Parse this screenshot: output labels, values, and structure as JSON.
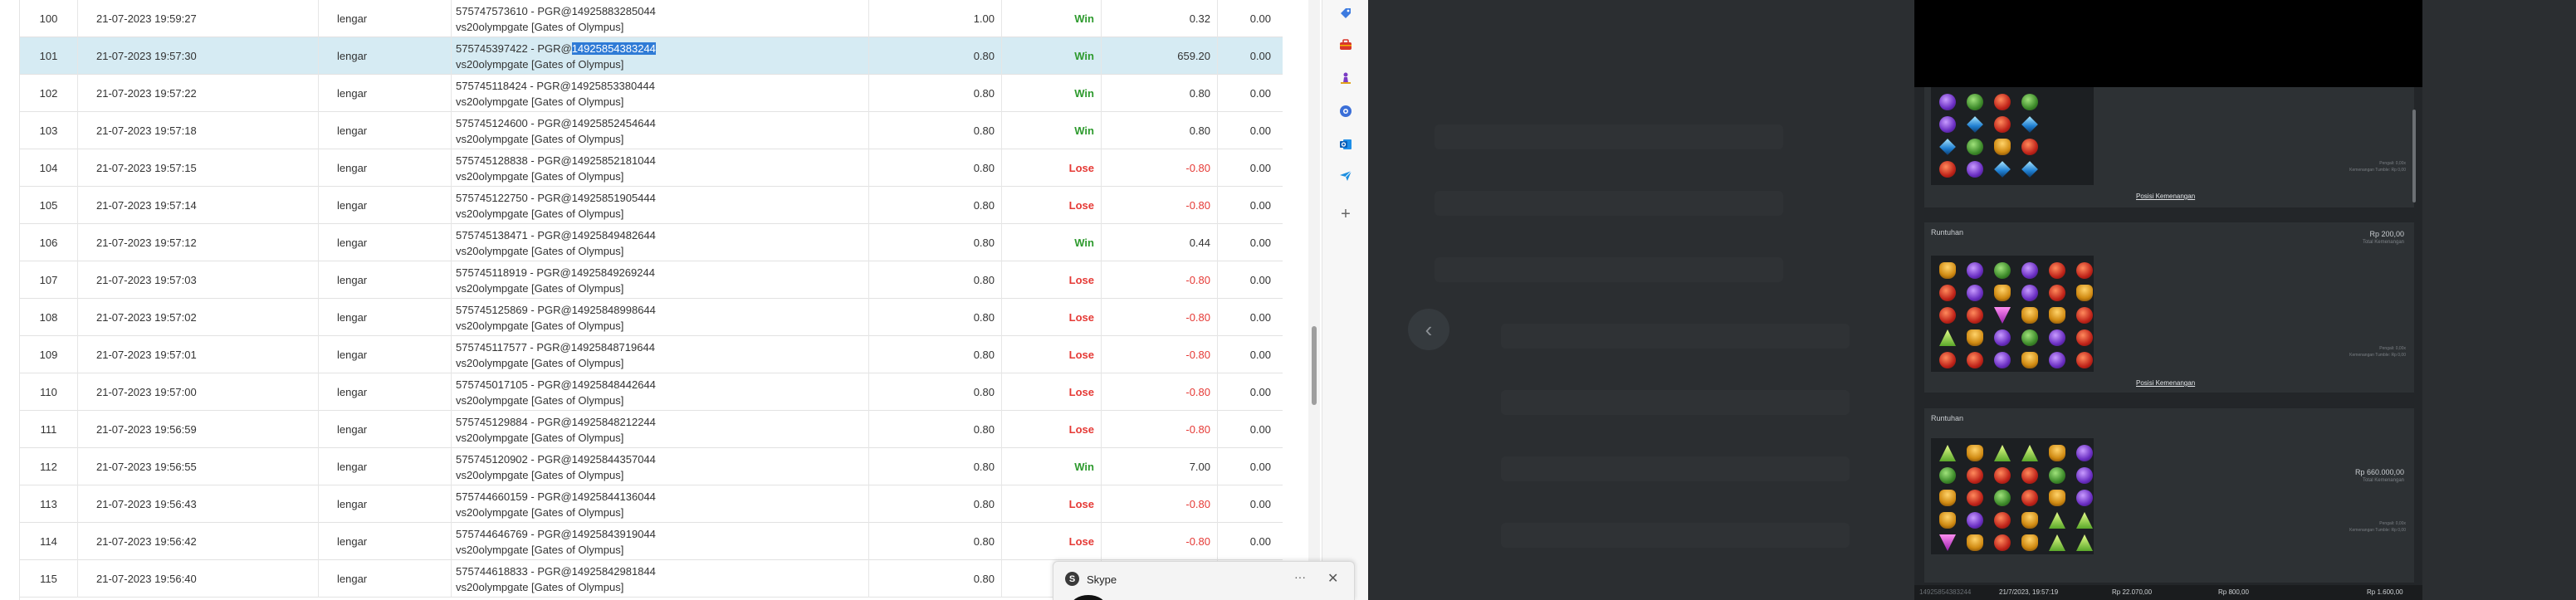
{
  "rows": [
    {
      "no": "100",
      "date": "21-07-2023 19:59:27",
      "user": "lengar",
      "ref_a": "575747573610 - PGR@14925883285044",
      "ref_hl": "",
      "ref_b": "",
      "game": "vs20olympgate [Gates of Olympus]",
      "bet": "1.00",
      "result": "Win",
      "win": "0.32",
      "balance": "0.00"
    },
    {
      "no": "101",
      "date": "21-07-2023 19:57:30",
      "user": "lengar",
      "ref_a": "575745397422 - PGR@",
      "ref_hl": "14925854383244",
      "ref_b": "",
      "game": "vs20olympgate [Gates of Olympus]",
      "bet": "0.80",
      "result": "Win",
      "win": "659.20",
      "balance": "0.00"
    },
    {
      "no": "102",
      "date": "21-07-2023 19:57:22",
      "user": "lengar",
      "ref_a": "575745118424 - PGR@14925853380444",
      "ref_hl": "",
      "ref_b": "",
      "game": "vs20olympgate [Gates of Olympus]",
      "bet": "0.80",
      "result": "Win",
      "win": "0.80",
      "balance": "0.00"
    },
    {
      "no": "103",
      "date": "21-07-2023 19:57:18",
      "user": "lengar",
      "ref_a": "575745124600 - PGR@14925852454644",
      "ref_hl": "",
      "ref_b": "",
      "game": "vs20olympgate [Gates of Olympus]",
      "bet": "0.80",
      "result": "Win",
      "win": "0.80",
      "balance": "0.00"
    },
    {
      "no": "104",
      "date": "21-07-2023 19:57:15",
      "user": "lengar",
      "ref_a": "575745128838 - PGR@14925852181044",
      "ref_hl": "",
      "ref_b": "",
      "game": "vs20olympgate [Gates of Olympus]",
      "bet": "0.80",
      "result": "Lose",
      "win": "-0.80",
      "balance": "0.00"
    },
    {
      "no": "105",
      "date": "21-07-2023 19:57:14",
      "user": "lengar",
      "ref_a": "575745122750 - PGR@14925851905444",
      "ref_hl": "",
      "ref_b": "",
      "game": "vs20olympgate [Gates of Olympus]",
      "bet": "0.80",
      "result": "Lose",
      "win": "-0.80",
      "balance": "0.00"
    },
    {
      "no": "106",
      "date": "21-07-2023 19:57:12",
      "user": "lengar",
      "ref_a": "575745138471 - PGR@14925849482644",
      "ref_hl": "",
      "ref_b": "",
      "game": "vs20olympgate [Gates of Olympus]",
      "bet": "0.80",
      "result": "Win",
      "win": "0.44",
      "balance": "0.00"
    },
    {
      "no": "107",
      "date": "21-07-2023 19:57:03",
      "user": "lengar",
      "ref_a": "575745118919 - PGR@14925849269244",
      "ref_hl": "",
      "ref_b": "",
      "game": "vs20olympgate [Gates of Olympus]",
      "bet": "0.80",
      "result": "Lose",
      "win": "-0.80",
      "balance": "0.00"
    },
    {
      "no": "108",
      "date": "21-07-2023 19:57:02",
      "user": "lengar",
      "ref_a": "575745125869 - PGR@14925848998644",
      "ref_hl": "",
      "ref_b": "",
      "game": "vs20olympgate [Gates of Olympus]",
      "bet": "0.80",
      "result": "Lose",
      "win": "-0.80",
      "balance": "0.00"
    },
    {
      "no": "109",
      "date": "21-07-2023 19:57:01",
      "user": "lengar",
      "ref_a": "575745117577 - PGR@14925848719644",
      "ref_hl": "",
      "ref_b": "",
      "game": "vs20olympgate [Gates of Olympus]",
      "bet": "0.80",
      "result": "Lose",
      "win": "-0.80",
      "balance": "0.00"
    },
    {
      "no": "110",
      "date": "21-07-2023 19:57:00",
      "user": "lengar",
      "ref_a": "575745017105 - PGR@14925848442644",
      "ref_hl": "",
      "ref_b": "",
      "game": "vs20olympgate [Gates of Olympus]",
      "bet": "0.80",
      "result": "Lose",
      "win": "-0.80",
      "balance": "0.00"
    },
    {
      "no": "111",
      "date": "21-07-2023 19:56:59",
      "user": "lengar",
      "ref_a": "575745129884 - PGR@14925848212244",
      "ref_hl": "",
      "ref_b": "",
      "game": "vs20olympgate [Gates of Olympus]",
      "bet": "0.80",
      "result": "Lose",
      "win": "-0.80",
      "balance": "0.00"
    },
    {
      "no": "112",
      "date": "21-07-2023 19:56:55",
      "user": "lengar",
      "ref_a": "575745120902 - PGR@14925844357044",
      "ref_hl": "",
      "ref_b": "",
      "game": "vs20olympgate [Gates of Olympus]",
      "bet": "0.80",
      "result": "Win",
      "win": "7.00",
      "balance": "0.00"
    },
    {
      "no": "113",
      "date": "21-07-2023 19:56:43",
      "user": "lengar",
      "ref_a": "575744660159 - PGR@14925844136044",
      "ref_hl": "",
      "ref_b": "",
      "game": "vs20olympgate [Gates of Olympus]",
      "bet": "0.80",
      "result": "Lose",
      "win": "-0.80",
      "balance": "0.00"
    },
    {
      "no": "114",
      "date": "21-07-2023 19:56:42",
      "user": "lengar",
      "ref_a": "575744646769 - PGR@14925843919044",
      "ref_hl": "",
      "ref_b": "",
      "game": "vs20olympgate [Gates of Olympus]",
      "bet": "0.80",
      "result": "Lose",
      "win": "-0.80",
      "balance": "0.00"
    },
    {
      "no": "115",
      "date": "21-07-2023 19:56:40",
      "user": "lengar",
      "ref_a": "575744618833 - PGR@14925842981844",
      "ref_hl": "",
      "ref_b": "",
      "game": "vs20olympgate [Gates of Olympus]",
      "bet": "0.80",
      "result": "L",
      "win": "",
      "balance": ""
    }
  ],
  "selected_row": "101",
  "side_rail": {
    "icons": [
      "tag-icon",
      "toolbox-icon",
      "chess-icon",
      "copilot-icon",
      "outlook-icon",
      "send-icon",
      "plus-icon"
    ],
    "plus_glyph": "+"
  },
  "skype": {
    "title": "Skype",
    "logo": "S",
    "menu": "···",
    "close": "✕"
  },
  "viewer": {
    "prev_glyph": "‹",
    "link_label": "Posisi Kemenangan",
    "panels": [
      {
        "title": "",
        "amount": "",
        "sub": "",
        "link": "Posisi Kemenangan",
        "info": "Pengali: 0,00x\nKemenangan Tumble: Rp 0,00"
      },
      {
        "title": "Runtuhan",
        "amount": "Rp 200,00",
        "sub": "Total Kemenangan",
        "link": "Posisi Kemenangan",
        "info": "Pengali: 0,00x\nKemenangan Tumble: Rp 0,00"
      },
      {
        "title": "Runtuhan",
        "amount": "Rp 660.000,00",
        "sub": "Total Kemenangan",
        "link": "",
        "info": "Pengali: 0,00x\nKemenangan Tumble: Rp 0,00"
      }
    ],
    "footer": {
      "ref": "14925854383244",
      "datetime": "21/7/2023, 19:57:19",
      "balance": "Rp 22.070,00",
      "bet": "Rp 800,00",
      "win": "Rp 1.600,00"
    }
  },
  "colors": {
    "win": "#2e9a2e",
    "lose": "#e53935",
    "selected_row": "#d6ebf3",
    "highlight": "#2f7bd6",
    "viewer_bg": "#2b2e31"
  }
}
